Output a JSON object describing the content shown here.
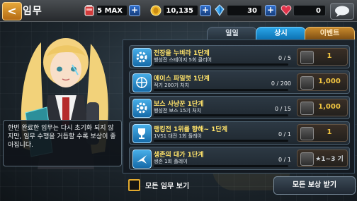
{
  "header": {
    "back_symbol": "<",
    "title": "임무",
    "resources": [
      {
        "name": "battery",
        "icon": "battery-icon",
        "value": "5 MAX"
      },
      {
        "name": "gold",
        "icon": "coin-icon",
        "value": "10,135"
      },
      {
        "name": "crystal",
        "icon": "crystal-icon",
        "value": "30"
      },
      {
        "name": "hearts",
        "icon": "heart-icon",
        "value": "0"
      }
    ],
    "plus_symbol": "+"
  },
  "tabs": [
    {
      "label": "일일",
      "active": false
    },
    {
      "label": "상시",
      "active": true
    },
    {
      "label": "이벤트",
      "active": false
    }
  ],
  "missions": [
    {
      "title": "전장을 누벼라 1단계",
      "desc": "행성전 스테이지 5회 클리어",
      "progress": "0 / 5",
      "fraction": 0.0,
      "reward_icon": "ticket-icon",
      "reward": "1"
    },
    {
      "title": "에이스 파일럿 1단계",
      "desc": "적기 200기 처치",
      "progress": "0 / 200",
      "fraction": 0.0,
      "reward_icon": "gold-bar-icon",
      "reward": "1,000"
    },
    {
      "title": "보스 사냥꾼 1단계",
      "desc": "행성전 보스 15기 처치",
      "progress": "0 / 15",
      "fraction": 0.0,
      "reward_icon": "gold-bar-icon",
      "reward": "1,000"
    },
    {
      "title": "랭킹전 1위를 향해~ 1단계",
      "desc": "1VS1 대전 1회 플레이",
      "progress": "0 / 1",
      "fraction": 0.0,
      "reward_icon": "ticket-icon",
      "reward": "1"
    },
    {
      "title": "생존의 대가 1단계",
      "desc": "생존 1회 플레이",
      "progress": "0 / 1",
      "fraction": 0.0,
      "reward_icon": "star-card-icon",
      "reward": "★1~3 기"
    }
  ],
  "info_text": "한번 완료한 임무는 다시 초기화 되지 않지만, 임무 수행을 거듭할 수록 보상이 좋아집니다.",
  "footer": {
    "show_all_label": "모든 임무 보기",
    "claim_all_label": "모든 보상 받기"
  },
  "colors": {
    "accent_gold": "#f2c641",
    "tab_active": "#2aa6e8",
    "tab_event": "#c98a2c",
    "mission_title": "#ffe36a"
  }
}
